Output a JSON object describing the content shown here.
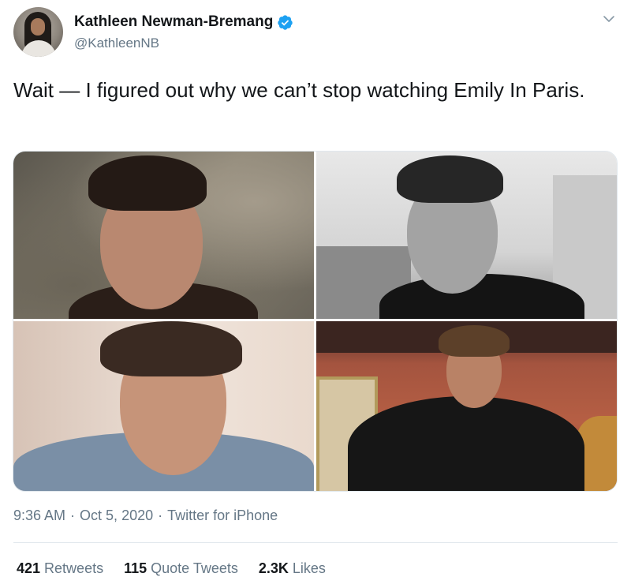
{
  "author": {
    "display_name": "Kathleen Newman-Bremang",
    "handle": "@KathleenNB",
    "verified": true,
    "avatar_icon": "profile-photo"
  },
  "tweet": {
    "text": "Wait — I figured out why we can’t stop watching Emily In Paris.",
    "media_count": 4
  },
  "meta": {
    "time": "9:36 AM",
    "separator1": "·",
    "date": "Oct 5, 2020",
    "separator2": "·",
    "source": "Twitter for iPhone"
  },
  "stats": {
    "retweets_count": "421",
    "retweets_label": "Retweets",
    "quote_count": "115",
    "quote_label": "Quote Tweets",
    "likes_count": "2.3K",
    "likes_label": "Likes"
  },
  "colors": {
    "verified_blue": "#1da1f2",
    "secondary_text": "#657786",
    "primary_text": "#14171a"
  }
}
